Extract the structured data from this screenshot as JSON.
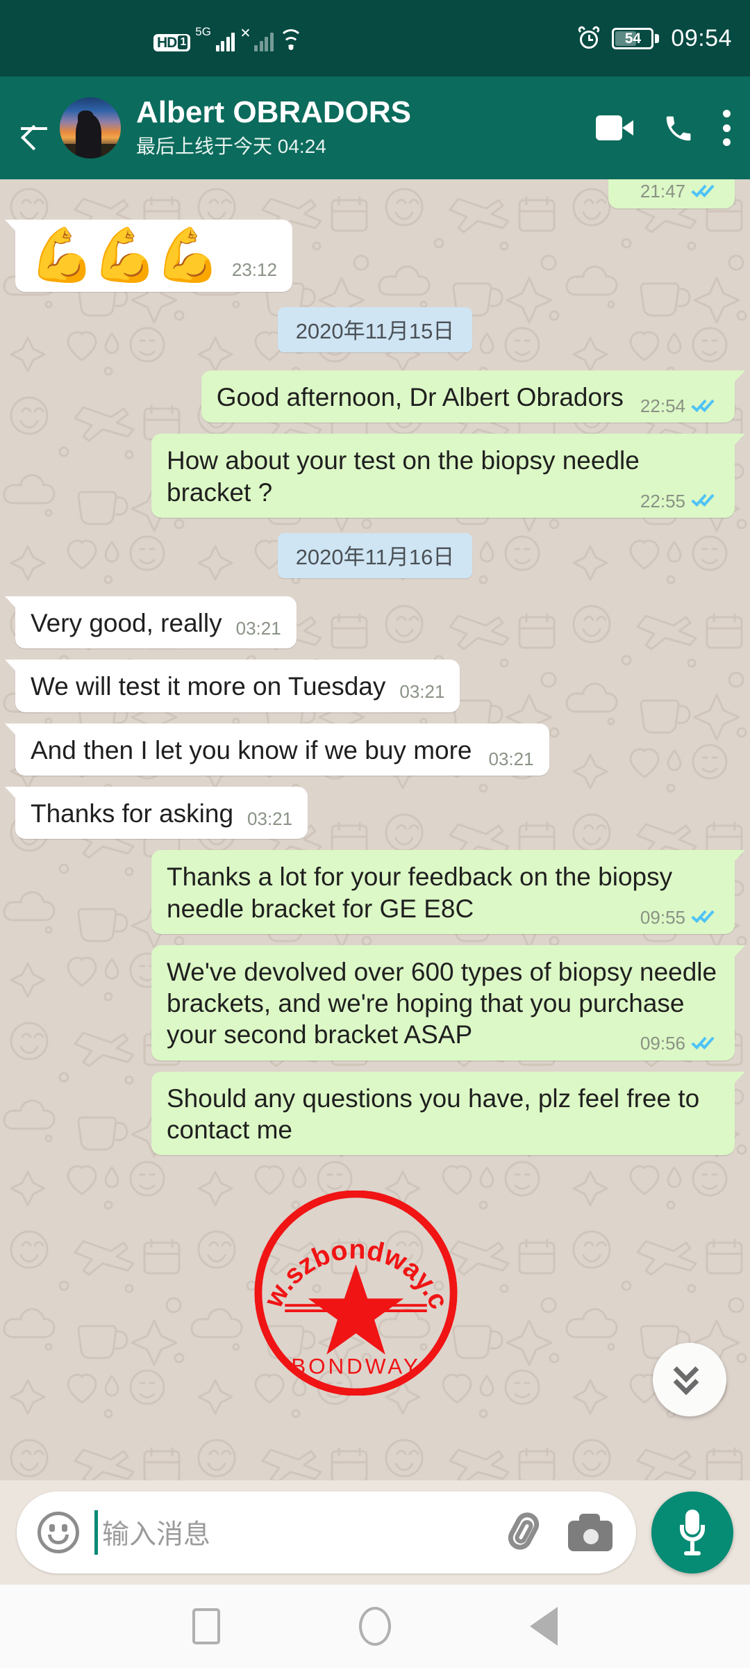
{
  "status_bar": {
    "hd_label": "HD",
    "sim_label": "1",
    "network_label": "5G",
    "signal_secondary_state": "no-service",
    "alarm_icon": "alarm-icon",
    "wifi_icon": "wifi-icon",
    "battery_percent": "54",
    "battery_level": 54,
    "time": "09:54"
  },
  "app_bar": {
    "back_icon": "back-arrow-icon",
    "avatar": "contact-avatar",
    "contact_name": "Albert OBRADORS",
    "contact_status": "最后上线于今天 04:24",
    "video_call_icon": "video-call-icon",
    "voice_call_icon": "voice-call-icon",
    "overflow_icon": "more-options-icon",
    "bg_color": "#0b6b5c"
  },
  "chat": {
    "background_color": "#ddd4cc",
    "outgoing_bubble_color": "#dcf8c6",
    "incoming_bubble_color": "#ffffff",
    "date_chip_color": "#cfe5f3",
    "tick_color": "#4fc3f7",
    "messages": [
      {
        "id": "m0",
        "type": "text",
        "dir": "out",
        "text": "",
        "time": "21:47",
        "status": "read",
        "clipped": true
      },
      {
        "id": "m1",
        "type": "sticker",
        "dir": "in",
        "text": "💪💪💪",
        "time": "23:12",
        "status": "none"
      },
      {
        "id": "d1",
        "type": "date",
        "text": "2020年11月15日"
      },
      {
        "id": "m2",
        "type": "text",
        "dir": "out",
        "text": "Good afternoon,  Dr Albert Obradors",
        "time": "22:54",
        "status": "read"
      },
      {
        "id": "m3",
        "type": "text",
        "dir": "out",
        "text": "How about your test on the biopsy needle bracket  ?",
        "time": "22:55",
        "status": "read"
      },
      {
        "id": "d2",
        "type": "date",
        "text": "2020年11月16日"
      },
      {
        "id": "m4",
        "type": "text",
        "dir": "in",
        "text": "Very good, really",
        "time": "03:21",
        "status": "none",
        "inline_time": true
      },
      {
        "id": "m5",
        "type": "text",
        "dir": "in",
        "text": "We will test it more on Tuesday",
        "time": "03:21",
        "status": "none",
        "inline_time": true
      },
      {
        "id": "m6",
        "type": "text",
        "dir": "in",
        "text": "And then I let you know if we buy more",
        "time": "03:21",
        "status": "none"
      },
      {
        "id": "m7",
        "type": "text",
        "dir": "in",
        "text": "Thanks for asking",
        "time": "03:21",
        "status": "none",
        "inline_time": true
      },
      {
        "id": "m8",
        "type": "text",
        "dir": "out",
        "text": "Thanks a lot for your feedback on the biopsy needle bracket for GE E8C",
        "time": "09:55",
        "status": "read"
      },
      {
        "id": "m9",
        "type": "text",
        "dir": "out",
        "text": "We've devolved over 600 types of biopsy needle brackets, and we're hoping that you purchase your second bracket ASAP",
        "time": "09:56",
        "status": "read"
      },
      {
        "id": "m10",
        "type": "text",
        "dir": "out",
        "text": "Should any questions you have, plz feel free to contact me",
        "time": "",
        "status": "none",
        "clipped_bottom": true
      }
    ]
  },
  "watermark": {
    "top_text": "www.szbondway.com",
    "bottom_text": "BONDWAY",
    "color": "#f01414",
    "shape": "circular-stamp-with-star"
  },
  "scroll_fab": {
    "icon": "double-chevron-down-icon"
  },
  "input_bar": {
    "emoji_icon": "emoji-icon",
    "placeholder": "输入消息",
    "value": "",
    "attach_icon": "attachment-clip-icon",
    "camera_icon": "camera-icon",
    "mic_icon": "microphone-icon",
    "mic_bg_color": "#068b74"
  },
  "nav_bar": {
    "recents_icon": "recents-square-icon",
    "home_icon": "home-circle-icon",
    "back_icon": "back-triangle-icon"
  }
}
